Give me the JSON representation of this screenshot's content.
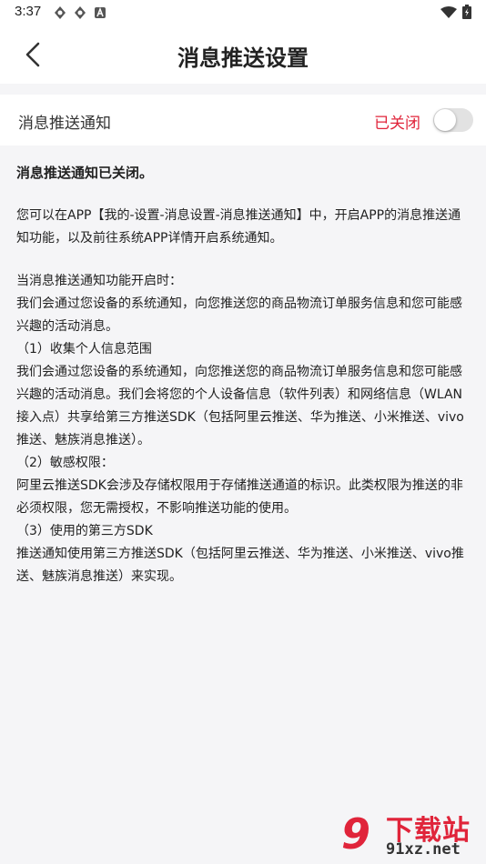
{
  "status_bar": {
    "time": "3:37"
  },
  "header": {
    "title": "消息推送设置"
  },
  "setting": {
    "label": "消息推送通知",
    "status": "已关闭",
    "enabled": false
  },
  "content": {
    "heading": "消息推送通知已关闭。",
    "para1": "您可以在APP【我的-设置-消息设置-消息推送通知】中，开启APP的消息推送通知功能，以及前往系统APP详情开启系统通知。",
    "para2": "当消息推送通知功能开启时：",
    "para3": "我们会通过您设备的系统通知，向您推送您的商品物流订单服务信息和您可能感兴趣的活动消息。",
    "sec1_title": "（1）收集个人信息范围",
    "sec1_body": "我们会通过您设备的系统通知，向您推送您的商品物流订单服务信息和您可能感兴趣的活动消息。我们会将您的个人设备信息（软件列表）和网络信息（WLAN接入点）共享给第三方推送SDK（包括阿里云推送、华为推送、小米推送、vivo推送、魅族消息推送）。",
    "sec2_title": "（2）敏感权限：",
    "sec2_body": "阿里云推送SDK会涉及存储权限用于存储推送通道的标识。此类权限为推送的非必须权限，您无需授权，不影响推送功能的使用。",
    "sec3_title": "（3）使用的第三方SDK",
    "sec3_body": "推送通知使用第三方推送SDK（包括阿里云推送、华为推送、小米推送、vivo推送、魅族消息推送）来实现。"
  },
  "watermark": {
    "logo": "9",
    "title": "下载站",
    "domain": "91xz.net"
  },
  "colors": {
    "accent": "#e0243a",
    "background": "#f5f5f7"
  }
}
